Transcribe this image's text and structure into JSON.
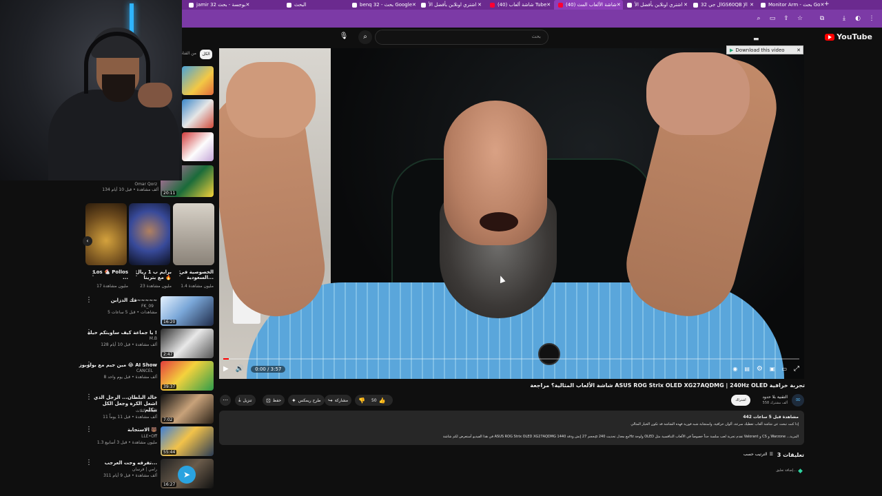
{
  "browser": {
    "tabs": [
      {
        "label": "jamir 32 بوجسة - بحث",
        "icon": "page-icon",
        "active": false
      },
      {
        "label": "البحث",
        "icon": "page-icon",
        "active": false
      },
      {
        "label": "benq 32 - بحث Google",
        "icon": "google-icon",
        "active": false
      },
      {
        "label": "اشتري اونلاين بأفضل الأ",
        "icon": "page-icon",
        "active": false
      },
      {
        "label": "(40) شاشة ألعاب Tube",
        "icon": "youtube-icon",
        "active": false
      },
      {
        "label": "(40) شاشة الألعاب المث",
        "icon": "youtube-icon",
        "active": true
      },
      {
        "label": "اشتري اونلاين بأفضل الأ",
        "icon": "page-icon",
        "active": false
      },
      {
        "label": "ال جي 32GS60QB الإ",
        "icon": "page-icon",
        "active": false
      },
      {
        "label": "Monitor Arm - بحث Go",
        "icon": "google-icon",
        "active": false
      }
    ]
  },
  "youtube": {
    "logo_text": "YouTube",
    "search_placeholder": "بحث",
    "filter_chip": "الكل",
    "filter_label": "من القناة"
  },
  "webcam": {
    "caption": "Omar Qorz"
  },
  "sidebar": {
    "top_video": {
      "meta": "134 ألف مشاهدة • قبل 10 أيام",
      "duration": "20:11"
    },
    "shorts": [
      {
        "title": "Los 🐔 Pollos ...",
        "meta": "17 مليون مشاهدة"
      },
      {
        "title": "برايم ب 1 ريال 🔥 مع بترينا",
        "meta": "23 مليون مشاهدة"
      },
      {
        "title": "الخصوصية في السعودية...",
        "meta": "1.4 مليون مشاهدة"
      }
    ],
    "videos": [
      {
        "title": "فك الدزاين~~~~~",
        "channel": "FK_09",
        "meta": "5 مشاهدات • قبل 5 ساعات",
        "duration": "16:20"
      },
      {
        "title": "يا جماعة كيف ساويتكم حيلة !",
        "channel": "M.B",
        "meta": "128 ألف مشاهدة • قبل 10 أيام",
        "duration": "2:47"
      },
      {
        "title": "مين جيم مع بولوبوز 😂 AI Show",
        "channel": "CANCEL",
        "meta": "8 ألف مشاهدة • قبل يوم واحد",
        "duration": "39:37"
      },
      {
        "title": "خالد البلطان... الرجل الذي اشعل الكرة وجعل الكل يتكلم",
        "channel": "البثاث الثلاث",
        "meta": "11 ألف مشاهدة • قبل 11 يوماً",
        "duration": "7:02"
      },
      {
        "title": "الاستجابة 🐻",
        "channel": "LLE•Off",
        "meta": "1.3 مليون مشاهدة • قبل 3 أسابيع",
        "duration": "55:44"
      },
      {
        "title": "تفرقه وجت العرجب...",
        "channel": "رامي | فرسان",
        "meta": "311 ألف مشاهدة • قبل 9 أيام",
        "duration": "16:27"
      }
    ]
  },
  "player": {
    "download_label": "Download this video",
    "time": "0:00 / 3:57",
    "progress": 0.01
  },
  "video": {
    "title": "شاشة الألعاب المثالية؟ مراجعة ASUS ROG Strix OLED XG27AQDMG | 240Hz OLED تجربة خرافية",
    "channel": "التقنية بلا حدود",
    "subscribers": "558 ألف مشترك",
    "subscribe_label": "اشتراك",
    "likes": "50",
    "share_label": "مشاركة",
    "remix_label": "طرح ريمكس",
    "save_label": "حفظ",
    "download_label": "تنزيل",
    "views_line": "442 مشاهدة  قبل 5 ساعات",
    "desc_line1": "إذا كنت تبحث عن شاشة ألعاب تعطيك سرعة، ألوان خرافية، واستجابة شبه فورية فهذه الشاشة قد تكون الخيار المثالي",
    "desc_line2": "في هذا الفيديو أستعرض لكم شاشة ASUS ROG Strix OLED XG27AQDMG بحجم 27 إنش ودقة 1440p مع معدل تحديث 240Hz ولوحة OLED تقدم تجربة لعب سلسة جداً خصوصاً في الألعاب التنافسية مثل Valorant و CS و Warzone ...المزيد"
  },
  "comments": {
    "count_label": "3 تعليقات",
    "sort_label": "الترتيب حسب",
    "add_placeholder": "إضافة تعليق..."
  }
}
